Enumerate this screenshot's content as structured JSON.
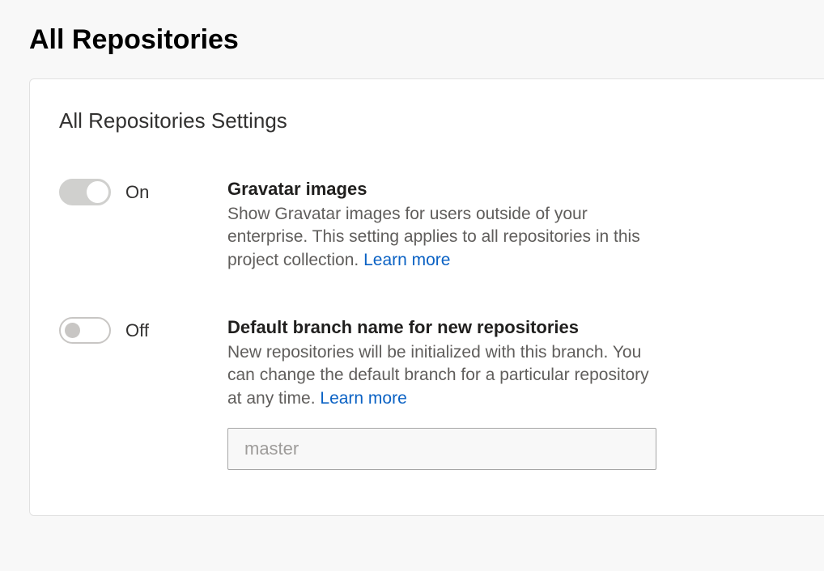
{
  "page": {
    "title": "All Repositories"
  },
  "card": {
    "title": "All Repositories Settings"
  },
  "toggle_labels": {
    "on": "On",
    "off": "Off"
  },
  "settings": {
    "gravatar": {
      "title": "Gravatar images",
      "desc_part1": "Show Gravatar images for users outside of your enterprise. This setting applies to all repositories in this project collection. ",
      "learn_more": "Learn more",
      "state": "on"
    },
    "default_branch": {
      "title": "Default branch name for new repositories",
      "desc_part1": "New repositories will be initialized with this branch. You can change the default branch for a particular repository at any time. ",
      "learn_more": "Learn more",
      "state": "off",
      "input_placeholder": "master",
      "input_value": ""
    }
  }
}
